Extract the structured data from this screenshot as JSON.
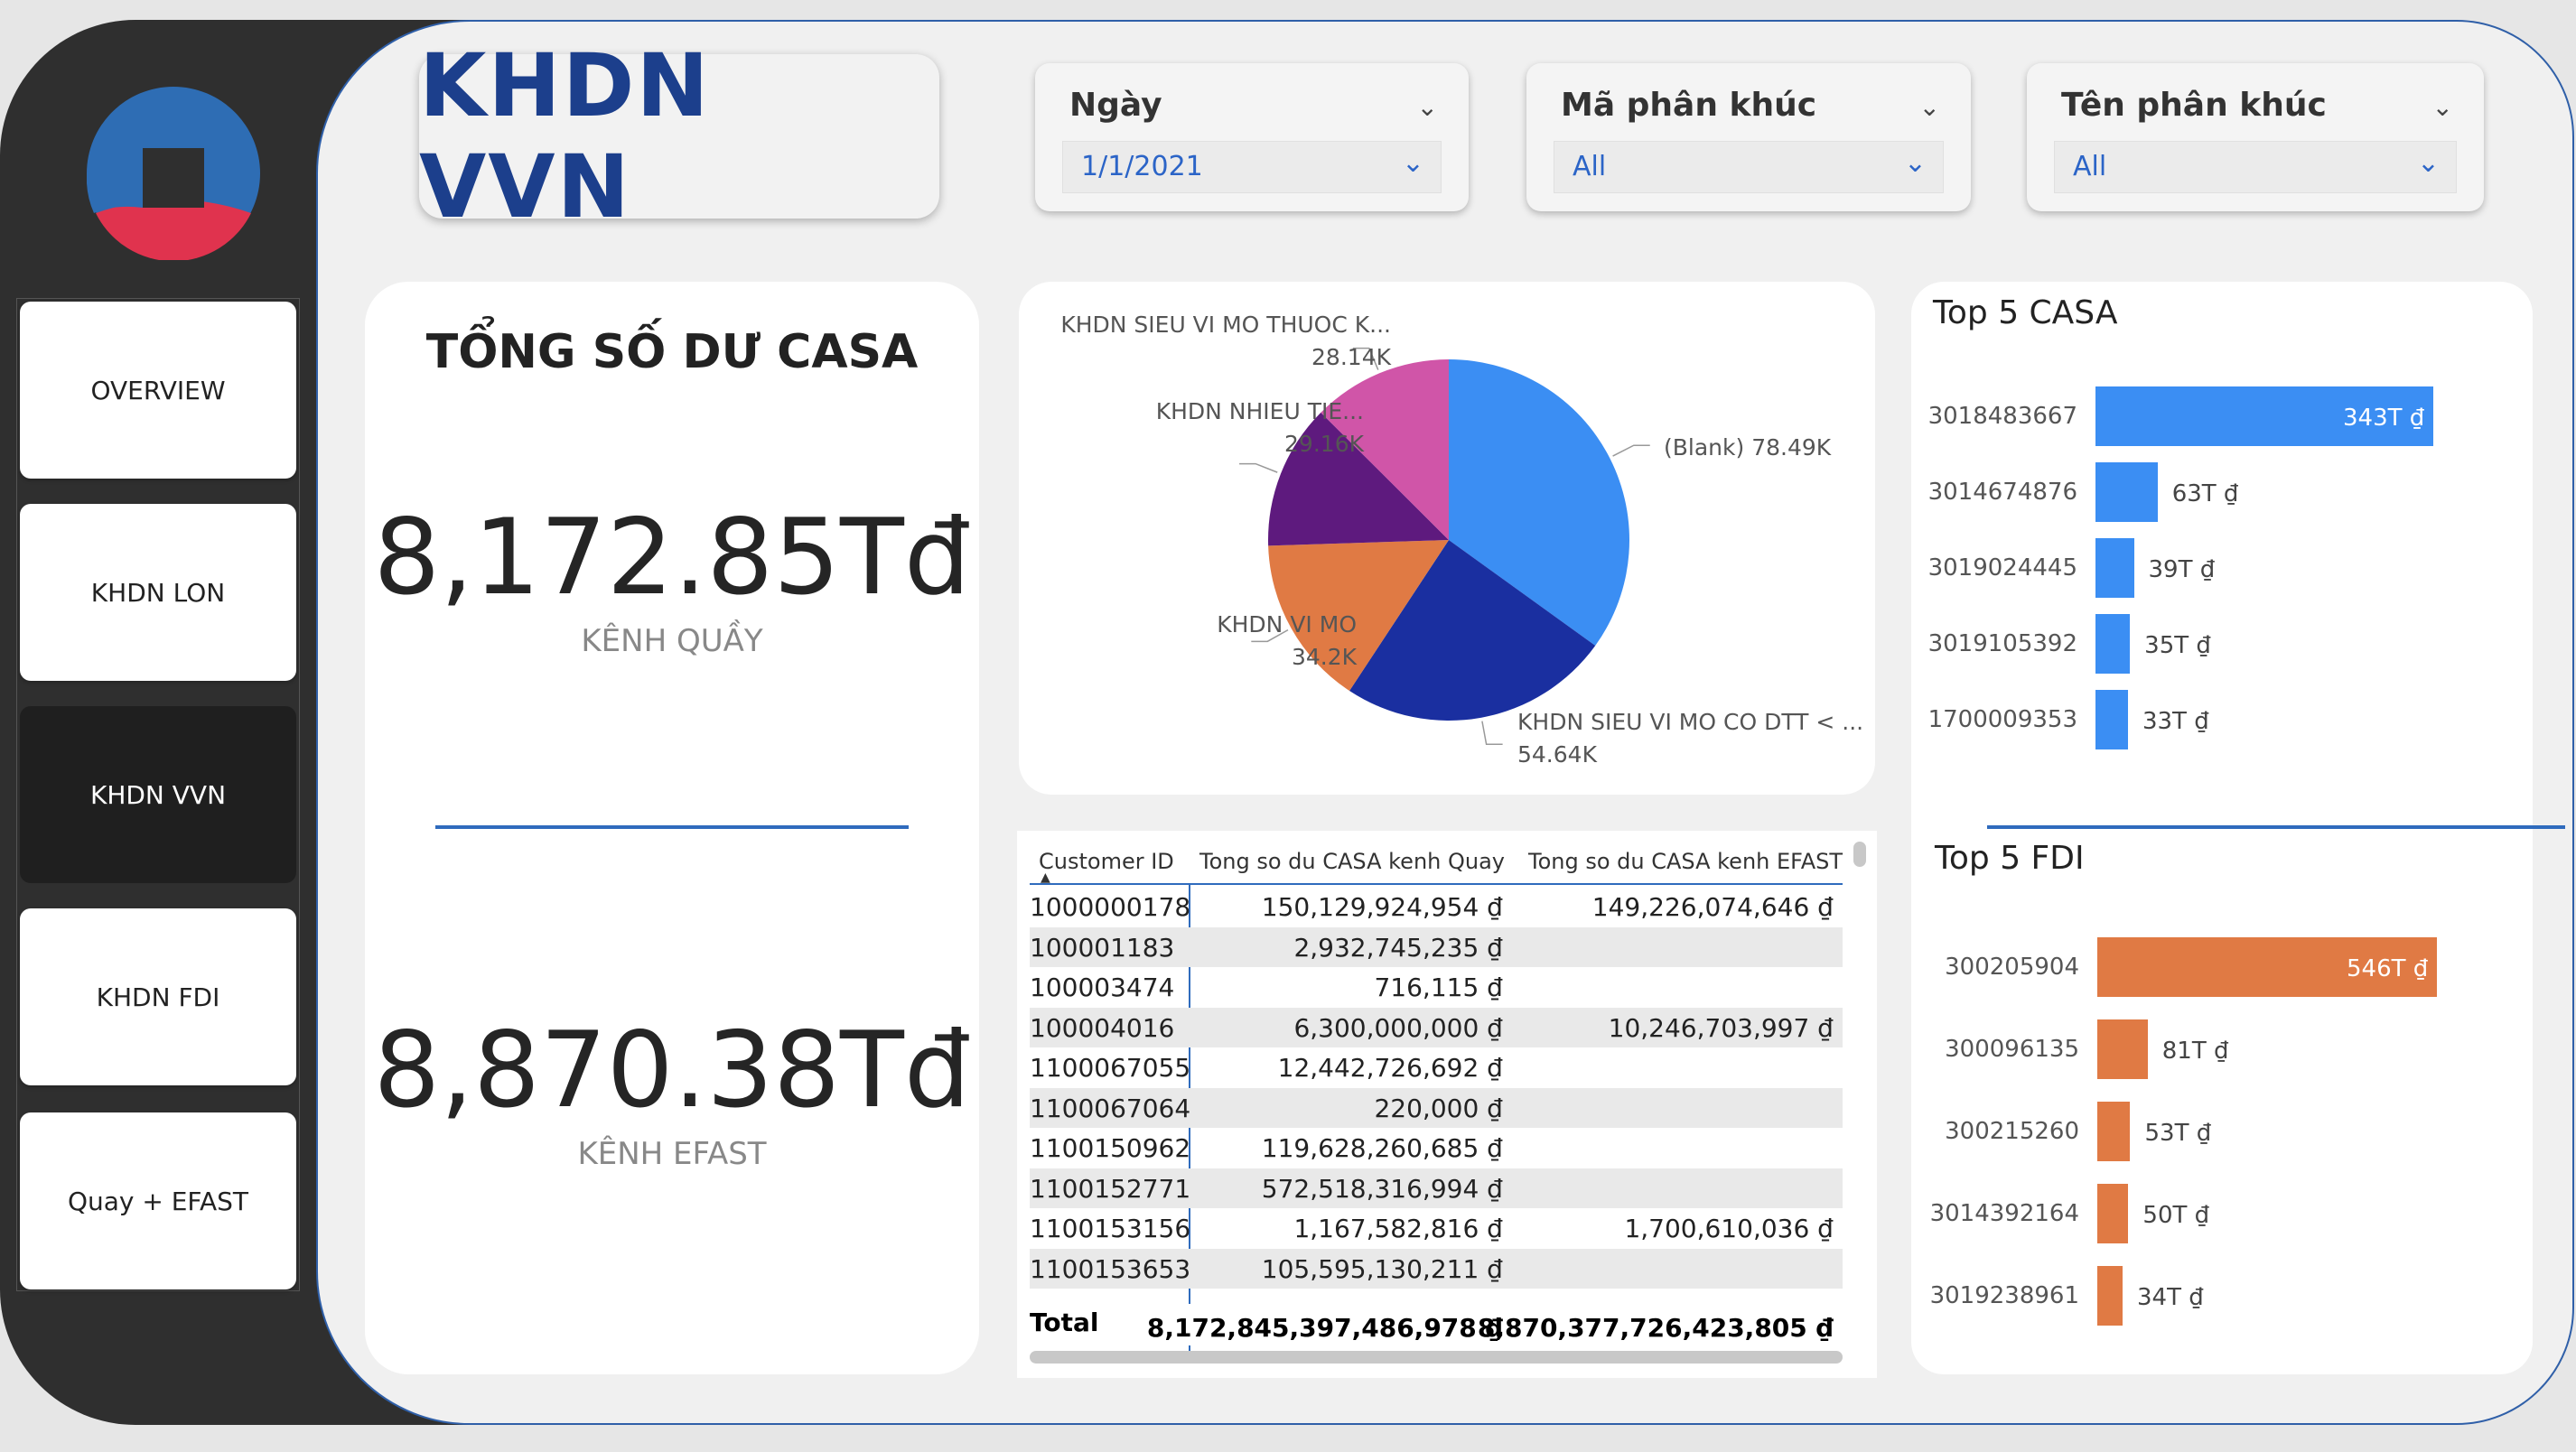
{
  "title": "KHDN VVN",
  "nav": [
    {
      "label": "OVERVIEW"
    },
    {
      "label": "KHDN LON"
    },
    {
      "label": "KHDN VVN"
    },
    {
      "label": "KHDN FDI"
    },
    {
      "label": "Quay + EFAST"
    }
  ],
  "slicers": [
    {
      "label": "Ngày",
      "value": "1/1/2021"
    },
    {
      "label": "Mã phân khúc",
      "value": "All"
    },
    {
      "label": "Tên phân khúc",
      "value": "All"
    }
  ],
  "casa": {
    "title": "TỔNG SỐ DƯ CASA",
    "quay_value": "8,172.85Tđ",
    "quay_label": "KÊNH QUẦY",
    "efast_value": "8,870.38Tđ",
    "efast_label": "KÊNH EFAST"
  },
  "pie_labels": {
    "blank": "(Blank) 78.49K",
    "sieu_vi_mo_co_dtt_name": "KHDN SIEU VI MO CO DTT < ...",
    "sieu_vi_mo_co_dtt_value": "54.64K",
    "vi_mo_name": "KHDN VI MO",
    "vi_mo_value": "34.2K",
    "nhieu_tie_name": "KHDN NHIEU TIE...",
    "nhieu_tie_value": "29.16K",
    "sieu_vi_mo_thuoc_name": "KHDN SIEU VI MO THUOC K...",
    "sieu_vi_mo_thuoc_value": "28.14K"
  },
  "table": {
    "headers": [
      "Customer ID",
      "Tong so du CASA kenh Quay",
      "Tong so du CASA kenh EFAST"
    ],
    "rows": [
      [
        "1000000178",
        "150,129,924,954 ₫",
        "149,226,074,646 ₫"
      ],
      [
        "100001183",
        "2,932,745,235 ₫",
        ""
      ],
      [
        "100003474",
        "716,115 ₫",
        ""
      ],
      [
        "100004016",
        "6,300,000,000 ₫",
        "10,246,703,997 ₫"
      ],
      [
        "1100067055",
        "12,442,726,692 ₫",
        ""
      ],
      [
        "1100067064",
        "220,000 ₫",
        ""
      ],
      [
        "1100150962",
        "119,628,260,685 ₫",
        ""
      ],
      [
        "1100152771",
        "572,518,316,994 ₫",
        ""
      ],
      [
        "1100153156",
        "1,167,582,816 ₫",
        "1,700,610,036 ₫"
      ],
      [
        "1100153653",
        "105,595,130,211 ₫",
        ""
      ]
    ],
    "total_label": "Total",
    "total_quay": "8,172,845,397,486,978 ₫",
    "total_efast": "8,870,377,726,423,805 ₫"
  },
  "top_casa_title": "Top 5 CASA",
  "top_fdi_title": "Top 5 FDI",
  "chart_data": [
    {
      "type": "pie",
      "categories": [
        "(Blank)",
        "KHDN SIEU VI MO CO DTT < ...",
        "KHDN VI MO",
        "KHDN NHIEU TIE...",
        "KHDN SIEU VI MO THUOC K..."
      ],
      "values": [
        78.49,
        54.64,
        34.2,
        29.16,
        28.14
      ],
      "colors": [
        "#3b8ef3",
        "#1a2fa0",
        "#e07a44",
        "#5e1a7e",
        "#d055a8"
      ]
    },
    {
      "type": "bar",
      "title": "Top 5 CASA",
      "categories": [
        "3018483667",
        "3014674876",
        "3019024445",
        "3019105392",
        "1700009353"
      ],
      "values": [
        343,
        63,
        39,
        35,
        33
      ],
      "labels": [
        "343T ₫",
        "63T ₫",
        "39T ₫",
        "35T ₫",
        "33T ₫"
      ],
      "color": "#3b8ef3"
    },
    {
      "type": "bar",
      "title": "Top 5 FDI",
      "categories": [
        "300205904",
        "300096135",
        "300215260",
        "3014392164",
        "3019238961"
      ],
      "values": [
        546,
        81,
        53,
        50,
        34
      ],
      "labels": [
        "546T ₫",
        "81T ₫",
        "53T ₫",
        "50T ₫",
        "34T ₫"
      ],
      "color": "#e07a44"
    }
  ]
}
